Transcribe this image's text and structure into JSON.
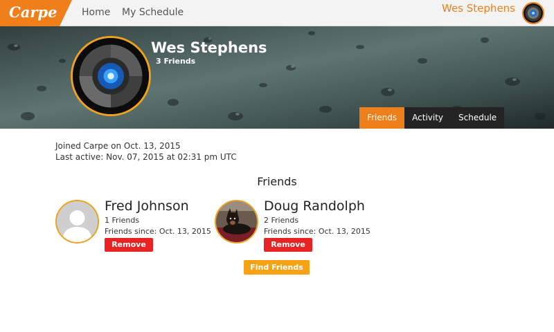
{
  "app": {
    "logo_text": "Carpe",
    "brand_color": "#ef7f1a"
  },
  "nav": {
    "home_label": "Home",
    "schedule_label": "My Schedule"
  },
  "current_user": {
    "name": "Wes Stephens",
    "avatar_icon": "robot-eye-avatar"
  },
  "profile": {
    "name": "Wes Stephens",
    "friends_count_label": "3 Friends",
    "avatar_icon": "robot-eye-avatar",
    "joined": "Joined Carpe on Oct. 13, 2015",
    "last_active": "Last active: Nov. 07, 2015 at 02:31 pm UTC"
  },
  "tabs": [
    {
      "label": "Friends",
      "active": true
    },
    {
      "label": "Activity",
      "active": false
    },
    {
      "label": "Schedule",
      "active": false
    }
  ],
  "friends_section": {
    "title": "Friends",
    "friends": [
      {
        "name": "Fred Johnson",
        "count_label": "1 Friends",
        "since": "Friends since: Oct. 13, 2015",
        "remove_label": "Remove",
        "avatar_icon": "default-person-avatar"
      },
      {
        "name": "Doug Randolph",
        "count_label": "2 Friends",
        "since": "Friends since: Oct. 13, 2015",
        "remove_label": "Remove",
        "avatar_icon": "dog-photo-avatar"
      }
    ],
    "find_button_label": "Find Friends"
  },
  "colors": {
    "accent": "#ef7f1a",
    "remove": "#e82323",
    "find": "#f5a314",
    "tab_dark": "#242424"
  }
}
